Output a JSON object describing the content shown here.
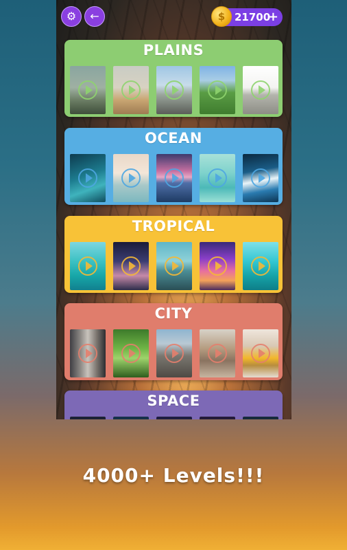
{
  "header": {
    "coins": "21700",
    "coin_symbol": "$",
    "plus_label": "+",
    "settings_icon": "gear-icon",
    "back_icon": "arrow-left-icon"
  },
  "categories": [
    {
      "title": "PLAINS",
      "color": "#8dcd72",
      "play_color": "#8fd46f"
    },
    {
      "title": "OCEAN",
      "color": "#56aee3",
      "play_color": "#4ea7e2"
    },
    {
      "title": "TROPICAL",
      "color": "#f8c237",
      "play_color": "#f6b936"
    },
    {
      "title": "CITY",
      "color": "#e07d6c",
      "play_color": "#e57f6d"
    },
    {
      "title": "SPACE",
      "color": "#7d69b6",
      "play_color": "#8a6dd0"
    }
  ],
  "promo_text": "4000+ Levels!!!"
}
